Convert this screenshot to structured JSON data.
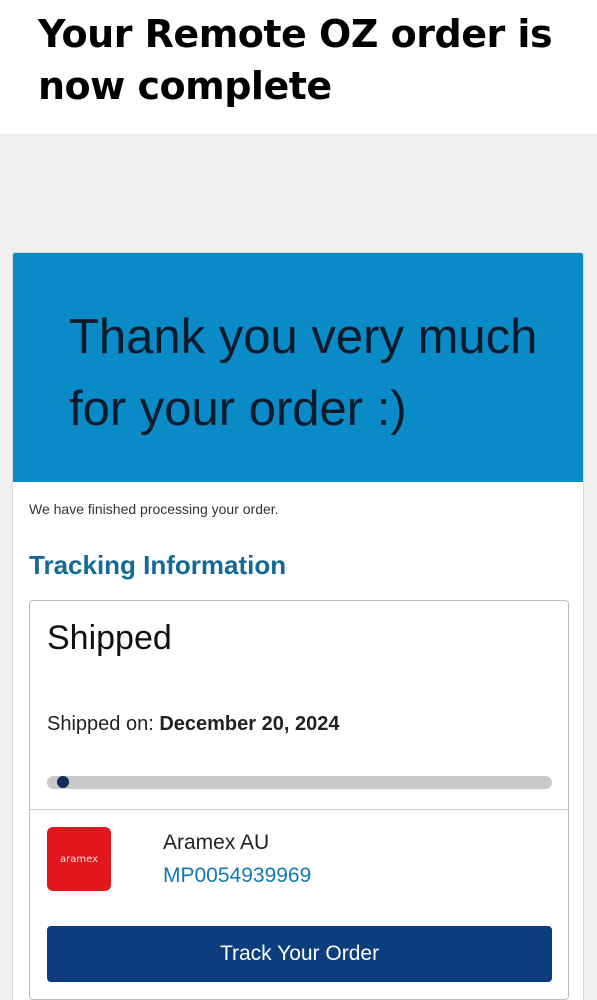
{
  "headline": "Your Remote OZ order is now complete",
  "email": {
    "hero_text": "Thank you very much for your order :)",
    "intro": "We have finished processing your order.",
    "section_title": "Tracking Information",
    "tracking": {
      "status": "Shipped",
      "shipped_on_label": "Shipped on:",
      "shipped_on_date": "December 20, 2024",
      "progress": 0.02,
      "carrier": {
        "logo_text": "aramex",
        "name": "Aramex AU",
        "tracking_number": "MP0054939969"
      },
      "button_label": "Track Your Order"
    }
  },
  "colors": {
    "hero": "#0a8bc8",
    "title": "#136a96",
    "link": "#1278b4",
    "button": "#0b3d7f",
    "carrier_logo": "#e2161c",
    "progress_dot": "#132a5a"
  },
  "icons": {
    "carrier_logo": "aramex-logo"
  }
}
